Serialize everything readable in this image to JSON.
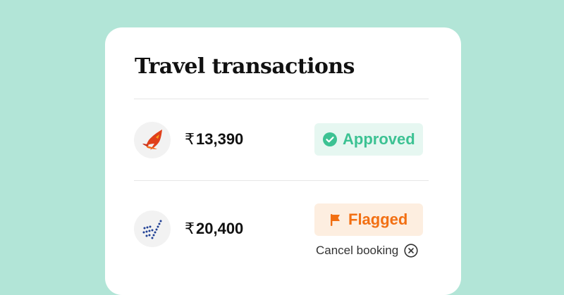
{
  "card": {
    "title": "Travel transactions"
  },
  "transactions": [
    {
      "airline_icon": "air-india-logo",
      "currency_symbol": "₹",
      "amount": "13,390",
      "status_label": "Approved",
      "status_icon": "check-circle-icon",
      "status_color": "#3cc293"
    },
    {
      "airline_icon": "indigo-logo",
      "currency_symbol": "₹",
      "amount": "20,400",
      "status_label": "Flagged",
      "status_icon": "flag-icon",
      "status_color": "#f26f12",
      "action_label": "Cancel booking",
      "action_icon": "close-circle-icon"
    }
  ],
  "colors": {
    "background": "#b2e5d7",
    "card": "#ffffff",
    "approved_bg": "#e6f7f1",
    "approved_text": "#3cc293",
    "flagged_bg": "#fdeee0",
    "flagged_text": "#f26f12"
  }
}
